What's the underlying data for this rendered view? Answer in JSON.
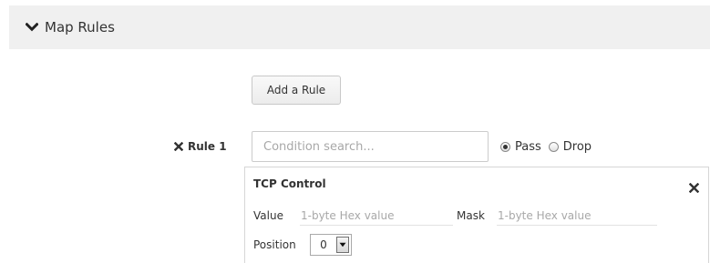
{
  "section": {
    "title": "Map Rules",
    "chevron_icon": "chevron-down-icon"
  },
  "add_rule_button": {
    "label": "Add a Rule"
  },
  "rule": {
    "label": "Rule 1",
    "remove_icon": "close-icon",
    "search": {
      "value": "",
      "placeholder": "Condition search..."
    },
    "actions": {
      "options": [
        "Pass",
        "Drop"
      ],
      "selected": "Pass"
    },
    "condition": {
      "title": "TCP Control",
      "close_icon": "close-icon",
      "value_label": "Value",
      "value_placeholder": "1-byte Hex value",
      "value": "",
      "mask_label": "Mask",
      "mask_placeholder": "1-byte Hex value",
      "mask": "",
      "position_label": "Position",
      "position_value": "0"
    }
  },
  "colors": {
    "header_bg": "#f0f0f0",
    "text": "#333333",
    "placeholder": "#a8a8a8",
    "border": "#cccccc"
  }
}
